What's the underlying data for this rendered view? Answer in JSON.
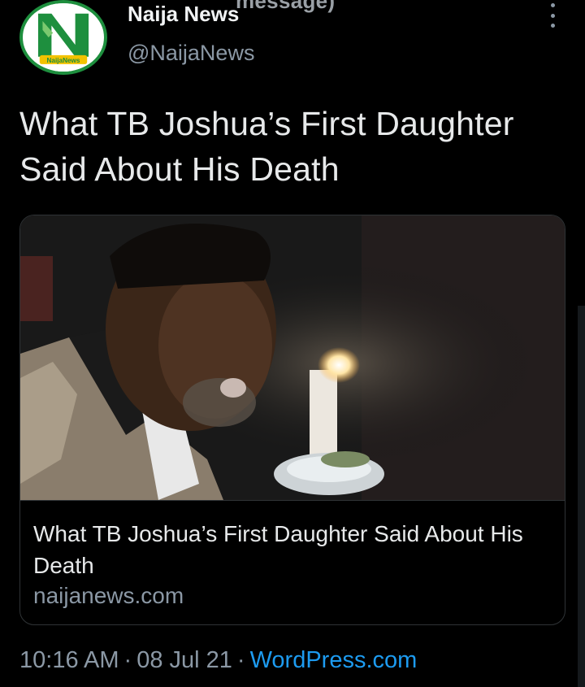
{
  "overflow_text": "message)",
  "author": {
    "name": "Naija News",
    "handle": "@NaijaNews",
    "avatar_badge": "NaijaNews"
  },
  "tweet": {
    "text": "What TB Joshua’s First Daughter Said About His Death"
  },
  "card": {
    "title": "What TB Joshua’s First Daughter Said About His Death",
    "domain": "naijanews.com"
  },
  "meta": {
    "time": "10:16 AM",
    "separator": "·",
    "date": "08 Jul 21",
    "source": "WordPress.com"
  },
  "icons": {
    "more": "more-vertical-icon"
  },
  "colors": {
    "background": "#000000",
    "text": "#e7e9ea",
    "secondary": "#8b98a5",
    "link": "#1d9bf0",
    "brand_green": "#1e8f3e"
  }
}
